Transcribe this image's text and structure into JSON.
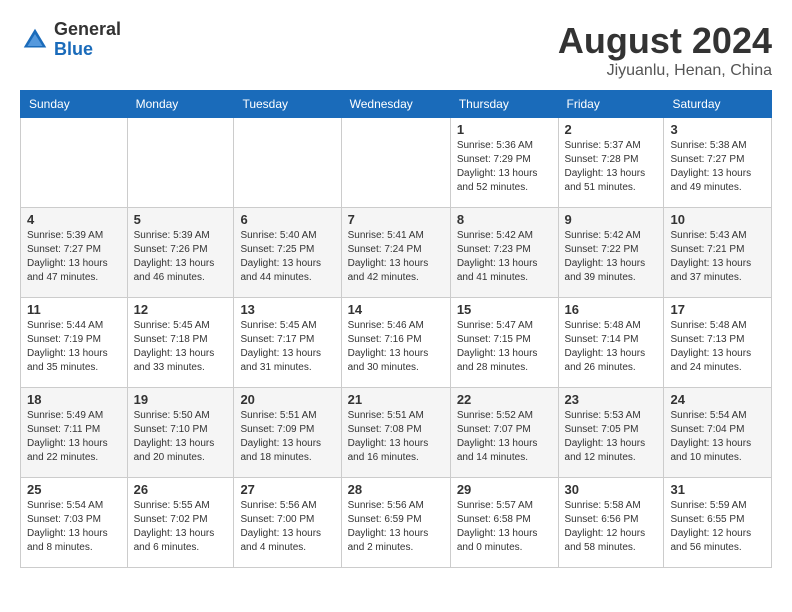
{
  "header": {
    "logo_general": "General",
    "logo_blue": "Blue",
    "month_title": "August 2024",
    "location": "Jiyuanlu, Henan, China"
  },
  "days_of_week": [
    "Sunday",
    "Monday",
    "Tuesday",
    "Wednesday",
    "Thursday",
    "Friday",
    "Saturday"
  ],
  "weeks": [
    [
      {
        "day": "",
        "info": ""
      },
      {
        "day": "",
        "info": ""
      },
      {
        "day": "",
        "info": ""
      },
      {
        "day": "",
        "info": ""
      },
      {
        "day": "1",
        "info": "Sunrise: 5:36 AM\nSunset: 7:29 PM\nDaylight: 13 hours\nand 52 minutes."
      },
      {
        "day": "2",
        "info": "Sunrise: 5:37 AM\nSunset: 7:28 PM\nDaylight: 13 hours\nand 51 minutes."
      },
      {
        "day": "3",
        "info": "Sunrise: 5:38 AM\nSunset: 7:27 PM\nDaylight: 13 hours\nand 49 minutes."
      }
    ],
    [
      {
        "day": "4",
        "info": "Sunrise: 5:39 AM\nSunset: 7:27 PM\nDaylight: 13 hours\nand 47 minutes."
      },
      {
        "day": "5",
        "info": "Sunrise: 5:39 AM\nSunset: 7:26 PM\nDaylight: 13 hours\nand 46 minutes."
      },
      {
        "day": "6",
        "info": "Sunrise: 5:40 AM\nSunset: 7:25 PM\nDaylight: 13 hours\nand 44 minutes."
      },
      {
        "day": "7",
        "info": "Sunrise: 5:41 AM\nSunset: 7:24 PM\nDaylight: 13 hours\nand 42 minutes."
      },
      {
        "day": "8",
        "info": "Sunrise: 5:42 AM\nSunset: 7:23 PM\nDaylight: 13 hours\nand 41 minutes."
      },
      {
        "day": "9",
        "info": "Sunrise: 5:42 AM\nSunset: 7:22 PM\nDaylight: 13 hours\nand 39 minutes."
      },
      {
        "day": "10",
        "info": "Sunrise: 5:43 AM\nSunset: 7:21 PM\nDaylight: 13 hours\nand 37 minutes."
      }
    ],
    [
      {
        "day": "11",
        "info": "Sunrise: 5:44 AM\nSunset: 7:19 PM\nDaylight: 13 hours\nand 35 minutes."
      },
      {
        "day": "12",
        "info": "Sunrise: 5:45 AM\nSunset: 7:18 PM\nDaylight: 13 hours\nand 33 minutes."
      },
      {
        "day": "13",
        "info": "Sunrise: 5:45 AM\nSunset: 7:17 PM\nDaylight: 13 hours\nand 31 minutes."
      },
      {
        "day": "14",
        "info": "Sunrise: 5:46 AM\nSunset: 7:16 PM\nDaylight: 13 hours\nand 30 minutes."
      },
      {
        "day": "15",
        "info": "Sunrise: 5:47 AM\nSunset: 7:15 PM\nDaylight: 13 hours\nand 28 minutes."
      },
      {
        "day": "16",
        "info": "Sunrise: 5:48 AM\nSunset: 7:14 PM\nDaylight: 13 hours\nand 26 minutes."
      },
      {
        "day": "17",
        "info": "Sunrise: 5:48 AM\nSunset: 7:13 PM\nDaylight: 13 hours\nand 24 minutes."
      }
    ],
    [
      {
        "day": "18",
        "info": "Sunrise: 5:49 AM\nSunset: 7:11 PM\nDaylight: 13 hours\nand 22 minutes."
      },
      {
        "day": "19",
        "info": "Sunrise: 5:50 AM\nSunset: 7:10 PM\nDaylight: 13 hours\nand 20 minutes."
      },
      {
        "day": "20",
        "info": "Sunrise: 5:51 AM\nSunset: 7:09 PM\nDaylight: 13 hours\nand 18 minutes."
      },
      {
        "day": "21",
        "info": "Sunrise: 5:51 AM\nSunset: 7:08 PM\nDaylight: 13 hours\nand 16 minutes."
      },
      {
        "day": "22",
        "info": "Sunrise: 5:52 AM\nSunset: 7:07 PM\nDaylight: 13 hours\nand 14 minutes."
      },
      {
        "day": "23",
        "info": "Sunrise: 5:53 AM\nSunset: 7:05 PM\nDaylight: 13 hours\nand 12 minutes."
      },
      {
        "day": "24",
        "info": "Sunrise: 5:54 AM\nSunset: 7:04 PM\nDaylight: 13 hours\nand 10 minutes."
      }
    ],
    [
      {
        "day": "25",
        "info": "Sunrise: 5:54 AM\nSunset: 7:03 PM\nDaylight: 13 hours\nand 8 minutes."
      },
      {
        "day": "26",
        "info": "Sunrise: 5:55 AM\nSunset: 7:02 PM\nDaylight: 13 hours\nand 6 minutes."
      },
      {
        "day": "27",
        "info": "Sunrise: 5:56 AM\nSunset: 7:00 PM\nDaylight: 13 hours\nand 4 minutes."
      },
      {
        "day": "28",
        "info": "Sunrise: 5:56 AM\nSunset: 6:59 PM\nDaylight: 13 hours\nand 2 minutes."
      },
      {
        "day": "29",
        "info": "Sunrise: 5:57 AM\nSunset: 6:58 PM\nDaylight: 13 hours\nand 0 minutes."
      },
      {
        "day": "30",
        "info": "Sunrise: 5:58 AM\nSunset: 6:56 PM\nDaylight: 12 hours\nand 58 minutes."
      },
      {
        "day": "31",
        "info": "Sunrise: 5:59 AM\nSunset: 6:55 PM\nDaylight: 12 hours\nand 56 minutes."
      }
    ]
  ]
}
